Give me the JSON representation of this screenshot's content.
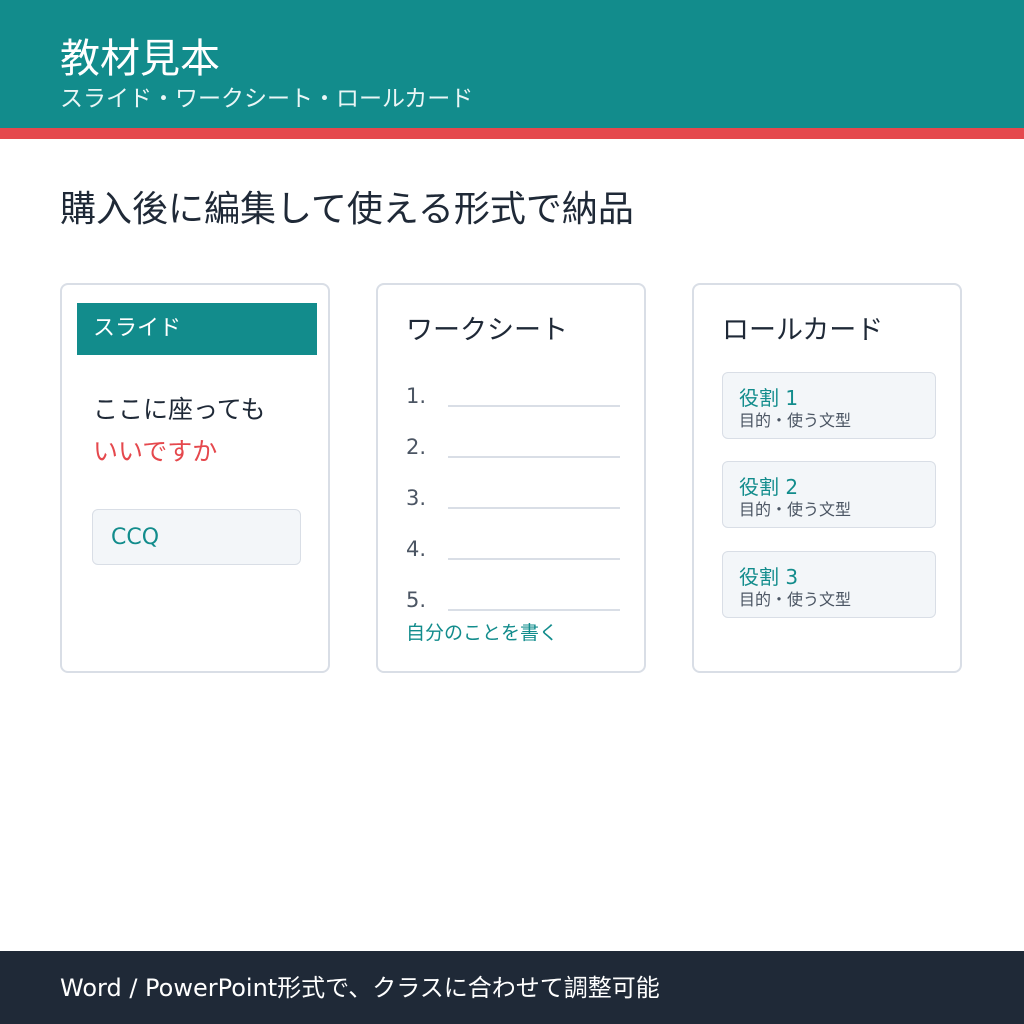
{
  "header": {
    "title": "教材見本",
    "subtitle": "スライド・ワークシート・ロールカード"
  },
  "headline": "購入後に編集して使える形式で納品",
  "cards": {
    "slide": {
      "band_label": "スライド",
      "line1": "ここに座っても",
      "line2": "いいですか",
      "ccq_label": "CCQ"
    },
    "worksheet": {
      "title": "ワークシート",
      "items": [
        "1.",
        "2.",
        "3.",
        "4.",
        "5."
      ],
      "footer": "自分のことを書く"
    },
    "rolecard": {
      "title": "ロールカード",
      "roles": [
        {
          "title": "役割 1",
          "subtitle": "目的・使う文型"
        },
        {
          "title": "役割 2",
          "subtitle": "目的・使う文型"
        },
        {
          "title": "役割 3",
          "subtitle": "目的・使う文型"
        }
      ]
    }
  },
  "footer": {
    "text": "Word / PowerPoint形式で、クラスに合わせて調整可能"
  },
  "colors": {
    "teal": "#128c8c",
    "accent_red": "#e5484d",
    "dark_navy": "#1f2937",
    "border_gray": "#d9dee6",
    "panel_bg": "#f3f6f9"
  }
}
